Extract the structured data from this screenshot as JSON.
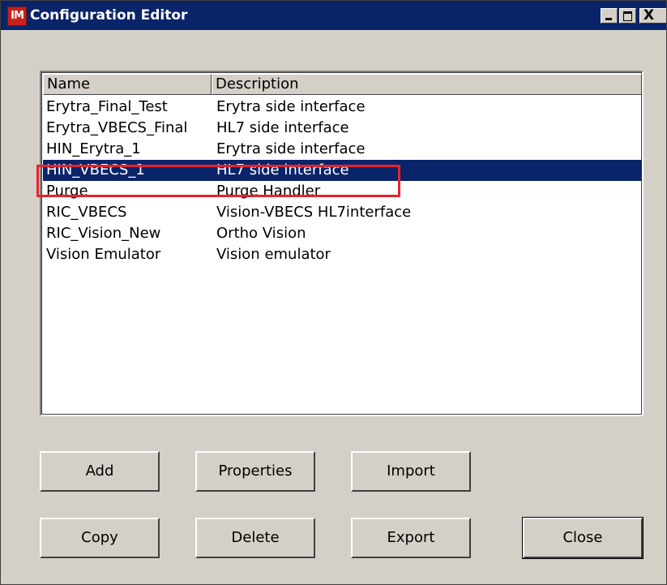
{
  "window": {
    "logo_text": "IM",
    "title": "Configuration Editor",
    "controls": {
      "minimize": "_",
      "maximize": "□",
      "close": "X"
    }
  },
  "list": {
    "columns": [
      "Name",
      "Description"
    ],
    "rows": [
      {
        "name": "Erytra_Final_Test",
        "description": "Erytra side interface"
      },
      {
        "name": "Erytra_VBECS_Final",
        "description": "HL7 side interface"
      },
      {
        "name": "HIN_Erytra_1",
        "description": "Erytra side interface"
      },
      {
        "name": "HIN_VBECS_1",
        "description": "HL7 side interface",
        "selected": true
      },
      {
        "name": "Purge",
        "description": "Purge Handler"
      },
      {
        "name": "RIC_VBECS",
        "description": "Vision-VBECS HL7interface"
      },
      {
        "name": "RIC_Vision_New",
        "description": "Ortho Vision"
      },
      {
        "name": "Vision Emulator",
        "description": "Vision emulator"
      }
    ]
  },
  "buttons": {
    "add": "Add",
    "properties": "Properties",
    "import": "Import",
    "copy": "Copy",
    "delete": "Delete",
    "export": "Export",
    "close": "Close"
  },
  "colors": {
    "titlebar": "#0a246a",
    "selection": "#0a246a",
    "highlight_box": "#e8232c"
  }
}
